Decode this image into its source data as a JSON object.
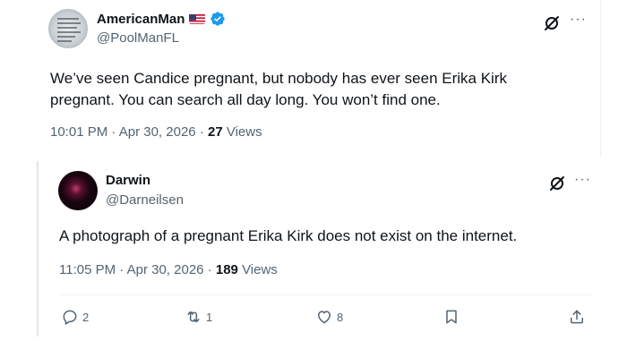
{
  "tweet": {
    "author": {
      "display_name": "AmericanMan",
      "handle": "@PoolManFL",
      "flag_icon": "us-flag-icon",
      "verified_icon": "verified-badge-icon",
      "verified_color": "#1d9bf0"
    },
    "text": "We’ve seen Candice pregnant, but nobody has ever seen Erika Kirk pregnant. You can search all day long. You won’t find one.",
    "time": "10:01 PM",
    "date": "Apr 30, 2026",
    "views_count": "27",
    "views_label": "Views"
  },
  "quoted_tweet": {
    "author": {
      "display_name": "Darwin",
      "handle": "@Darneilsen"
    },
    "text": "A photograph of a pregnant Erika Kirk does not exist on the internet.",
    "time": "11:05 PM",
    "date": "Apr 30, 2026",
    "views_count": "189",
    "views_label": "Views"
  },
  "header_icons": {
    "grok": "grok-icon",
    "more": "more-icon"
  },
  "actions": {
    "reply": {
      "icon": "reply-icon",
      "count": "2"
    },
    "repost": {
      "icon": "repost-icon",
      "count": "1"
    },
    "like": {
      "icon": "heart-icon",
      "count": "8"
    },
    "bookmark": {
      "icon": "bookmark-icon"
    },
    "share": {
      "icon": "share-icon"
    }
  },
  "colors": {
    "text_primary": "#0f1419",
    "text_secondary": "#536471",
    "divider": "#eff3f4"
  }
}
